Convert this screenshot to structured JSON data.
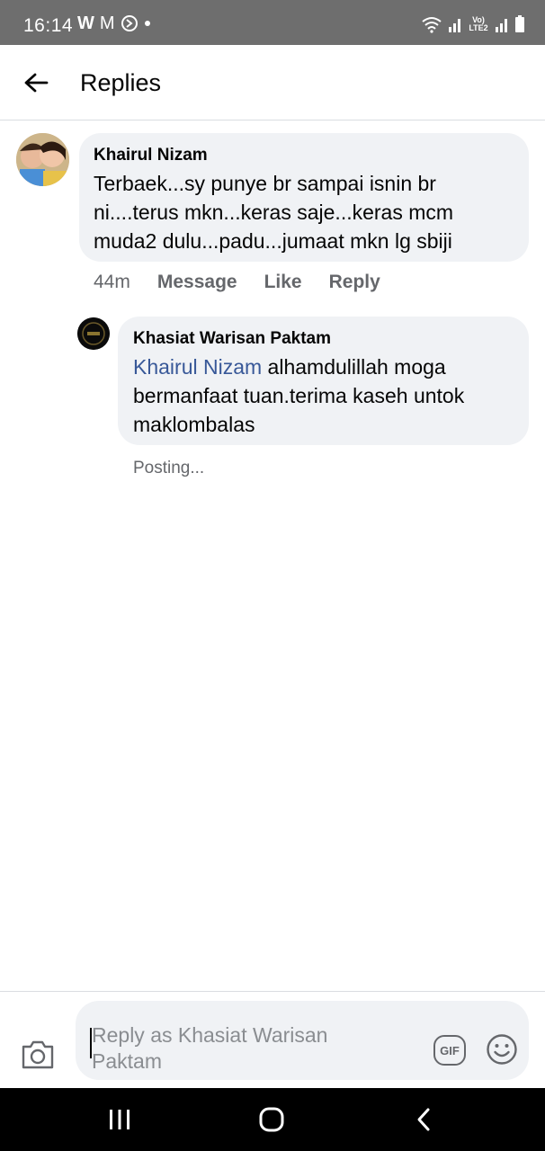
{
  "status_bar": {
    "time": "16:14",
    "left_icons": [
      "W",
      "M"
    ],
    "network": "Vo) LTE2"
  },
  "header": {
    "title": "Replies"
  },
  "comment": {
    "author": "Khairul Nizam",
    "text": "Terbaek...sy punye br sampai isnin br ni....terus mkn...keras saje...keras mcm muda2 dulu...padu...jumaat mkn lg sbiji",
    "time": "44m",
    "actions": [
      "Message",
      "Like",
      "Reply"
    ]
  },
  "reply": {
    "author": "Khasiat Warisan Paktam",
    "mention": "Khairul Nizam",
    "text": " alhamdulillah moga bermanfaat tuan.terima kaseh untok maklombalas",
    "status": "Posting..."
  },
  "composer": {
    "placeholder": "Reply as Khasiat Warisan Paktam",
    "gif_label": "GIF"
  },
  "colors": {
    "mention": "#385898",
    "bubble": "#f0f2f5",
    "meta": "#65676b"
  }
}
